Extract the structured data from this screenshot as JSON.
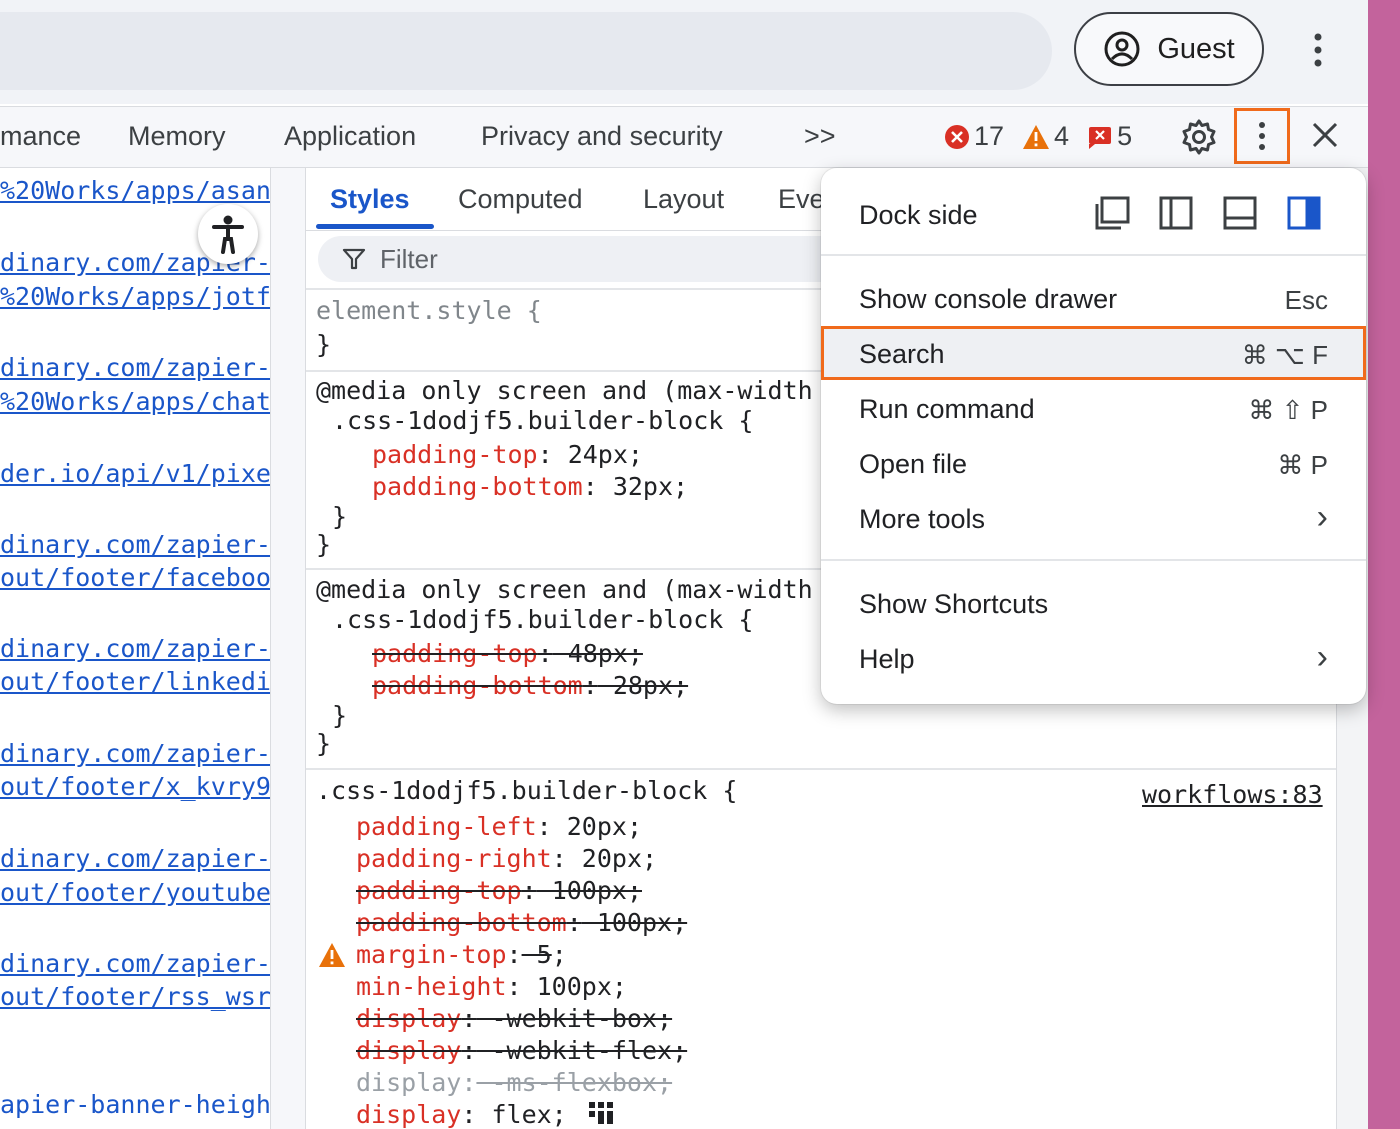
{
  "browser": {
    "profile_label": "Guest"
  },
  "devtools": {
    "tabs": [
      "mance",
      "Memory",
      "Application",
      "Privacy and security"
    ],
    "overflow_glyph": ">>",
    "errors": "17",
    "warnings": "4",
    "issues": "5"
  },
  "sources": {
    "lines": [
      "%20Works/apps/asan",
      "dinary.com/zapier-",
      "%20Works/apps/jotf",
      "dinary.com/zapier-",
      "%20Works/apps/chat",
      "der.io/api/v1/pixe",
      "dinary.com/zapier-",
      "out/footer/faceboo",
      "dinary.com/zapier-",
      "out/footer/linkedi",
      "dinary.com/zapier-",
      "out/footer/x_kvry9",
      "dinary.com/zapier-",
      "out/footer/youtube",
      "dinary.com/zapier-",
      "out/footer/rss_wsr",
      "apier-banner-heigh"
    ]
  },
  "styles_pane": {
    "tabs": [
      "Styles",
      "Computed",
      "Layout",
      "Eve"
    ],
    "filter_placeholder": "Filter",
    "element_style": "element.style {",
    "close_brace": "}",
    "media1": "@media only screen and (max-width",
    "selector": ".css-1dodjf5.builder-block {",
    "rule1": [
      {
        "prop": "padding-top",
        "value": " 24px;"
      },
      {
        "prop": "padding-bottom",
        "value": " 32px;"
      }
    ],
    "rule2": [
      {
        "prop": "padding-top",
        "value": " 48px;"
      },
      {
        "prop": "padding-bottom",
        "value": " 28px;"
      }
    ],
    "source_link": "workflows:83",
    "rule3": [
      {
        "prop": "padding-left",
        "value": " 20px;"
      },
      {
        "prop": "padding-right",
        "value": " 20px;"
      },
      {
        "prop": "padding-top",
        "value": " 100px;"
      },
      {
        "prop": "padding-bottom",
        "value": " 100px;"
      },
      {
        "prop": "margin-top",
        "value": " 5"
      },
      {
        "prop": "min-height",
        "value": " 100px;"
      },
      {
        "prop": "display",
        "value": " -webkit-box;"
      },
      {
        "prop": "display",
        "value": " -webkit-flex;"
      },
      {
        "prop": "display",
        "value": " -ms-flexbox;"
      },
      {
        "prop": "display",
        "value": " flex;"
      }
    ]
  },
  "menu": {
    "dock_side": "Dock side",
    "items": [
      {
        "label": "Show console drawer",
        "shortcut": "Esc"
      },
      {
        "label": "Search",
        "shortcut": "⌘ ⌥ F"
      },
      {
        "label": "Run command",
        "shortcut": "⌘ ⇧ P"
      },
      {
        "label": "Open file",
        "shortcut": "⌘ P"
      },
      {
        "label": "More tools",
        "shortcut": "›"
      },
      {
        "label": "Show Shortcuts",
        "shortcut": ""
      },
      {
        "label": "Help",
        "shortcut": "›"
      }
    ]
  },
  "colors": {
    "accent": "#1a56c9",
    "highlight": "#f06a1b",
    "error": "#d93025",
    "warning": "#e8710a"
  }
}
